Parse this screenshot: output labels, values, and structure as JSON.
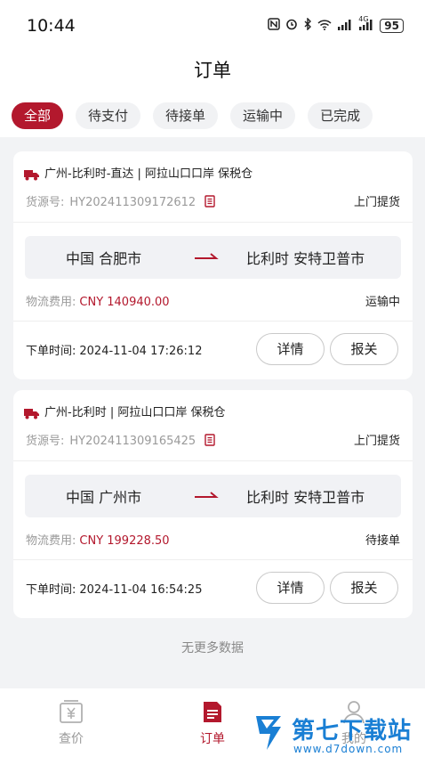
{
  "status": {
    "time": "10:44",
    "icons": [
      "nfc-icon",
      "alarm-icon",
      "bluetooth-icon",
      "wifi-icon",
      "signal-icon",
      "signal-4g-icon"
    ],
    "net_label": "4G",
    "battery": "95"
  },
  "header": {
    "title": "订单"
  },
  "tabs": [
    {
      "label": "全部",
      "active": true
    },
    {
      "label": "待支付",
      "active": false
    },
    {
      "label": "待接单",
      "active": false
    },
    {
      "label": "运输中",
      "active": false
    },
    {
      "label": "已完成",
      "active": false
    }
  ],
  "orders": [
    {
      "route_name": "广州-比利时-直达 | 阿拉山口口岸 保税仓",
      "source_label": "货源号:",
      "source_no": "HY202411309172612",
      "pickup": "上门提货",
      "from": "中国 合肥市",
      "to": "比利时 安特卫普市",
      "fee_label": "物流费用:",
      "fee_value": "CNY 140940.00",
      "state": "运输中",
      "time_label": "下单时间:",
      "time_value": "2024-11-04 17:26:12",
      "detail_btn": "详情",
      "customs_btn": "报关"
    },
    {
      "route_name": "广州-比利时 | 阿拉山口口岸 保税仓",
      "source_label": "货源号:",
      "source_no": "HY202411309165425",
      "pickup": "上门提货",
      "from": "中国 广州市",
      "to": "比利时 安特卫普市",
      "fee_label": "物流费用:",
      "fee_value": "CNY 199228.50",
      "state": "待接单",
      "time_label": "下单时间:",
      "time_value": "2024-11-04 16:54:25",
      "detail_btn": "详情",
      "customs_btn": "报关"
    }
  ],
  "list_end": "无更多数据",
  "nav": [
    {
      "label": "查价",
      "icon": "price-icon",
      "active": false
    },
    {
      "label": "订单",
      "icon": "order-icon",
      "active": true
    },
    {
      "label": "我的",
      "icon": "profile-icon",
      "active": false
    }
  ],
  "watermark": {
    "title": "第七下载站",
    "url": "www.d7down.com"
  },
  "colors": {
    "accent": "#b3182d",
    "watermark": "#1a7fd4",
    "background": "#f2f3f5"
  }
}
